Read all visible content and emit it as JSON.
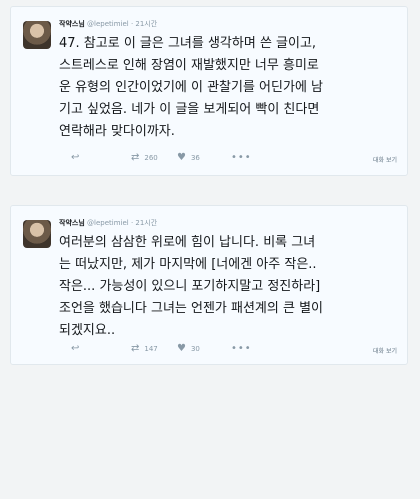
{
  "tweets": [
    {
      "author": "작약스님",
      "handle": "@lepetimiel",
      "time": "· 21시간",
      "lines": [
        "47. 참고로 이 글은 그녀를 생각하며 쓴 글이고,",
        "스트레스로 인해 장염이 재발했지만 너무 흥미로",
        "운 유형의 인간이었기에 이 관찰기를 어딘가에 남",
        "기고 싶었음. 네가 이 글을 보게되어 빡이 친다면",
        "연락해라 맞다이까자."
      ],
      "retweets": "260",
      "likes": "36",
      "detail_label": "대화 보기"
    },
    {
      "author": "작약스님",
      "handle": "@lepetimiel",
      "time": "· 21시간",
      "lines": [
        "여러분의 삼삼한 위로에 힘이 납니다. 비록 그녀",
        "는 떠났지만, 제가 마지막에 [너에겐 아주 작은..",
        "작은... 가능성이 있으니 포기하지말고 정진하라]",
        "조언을 했습니다 그녀는 언젠가 패션계의 큰 별이",
        "되겠지요.."
      ],
      "retweets": "147",
      "likes": "30",
      "detail_label": "대화 보기"
    }
  ],
  "icons": {
    "reply": "reply-icon",
    "retweet": "retweet-icon",
    "like": "heart-icon",
    "more": "more-icon"
  }
}
